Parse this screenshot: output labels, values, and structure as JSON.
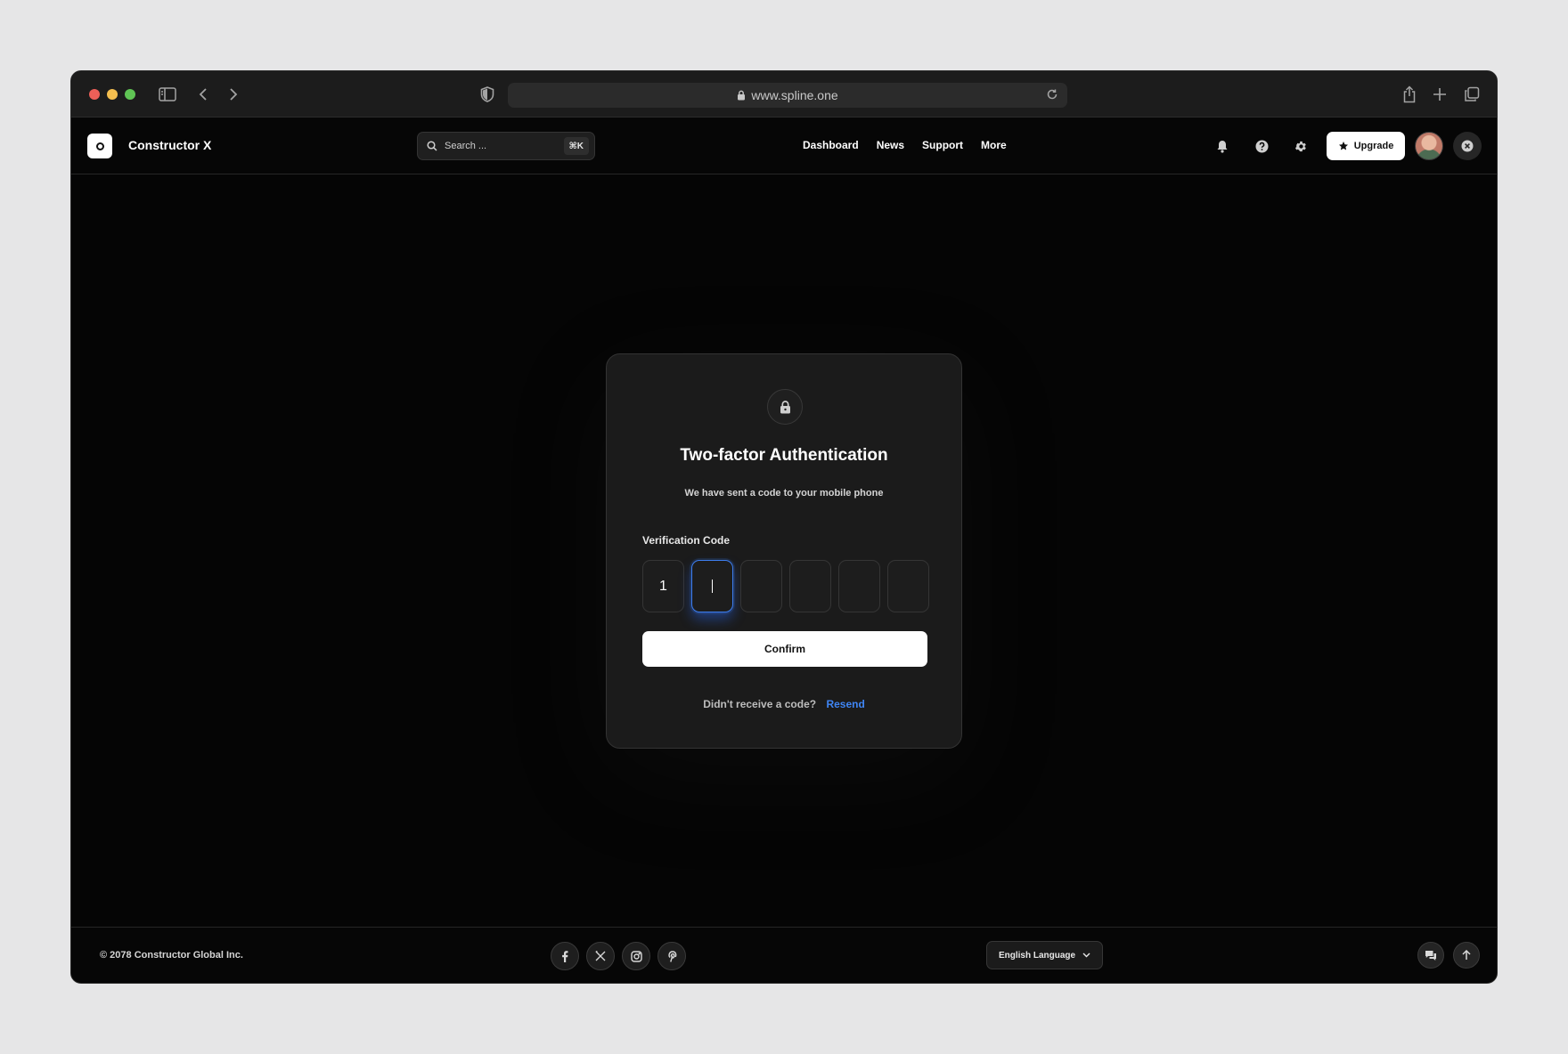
{
  "browser": {
    "url": "www.spline.one",
    "icons": [
      "sidebar-icon",
      "back-icon",
      "forward-icon",
      "shield-icon",
      "lock-icon",
      "reload-icon",
      "share-icon",
      "new-tab-icon",
      "tabs-icon"
    ]
  },
  "header": {
    "brand": "Constructor X",
    "search": {
      "placeholder": "Search ...",
      "shortcut": "⌘K"
    },
    "nav": [
      "Dashboard",
      "News",
      "Support",
      "More"
    ],
    "upgrade_label": "Upgrade"
  },
  "modal": {
    "title": "Two-factor Authentication",
    "subtitle": "We have sent a code to your mobile phone",
    "code_label": "Verification Code",
    "digits": [
      "1",
      "",
      "",
      "",
      "",
      ""
    ],
    "active_index": 1,
    "confirm_label": "Confirm",
    "resend_question": "Didn't receive a code?",
    "resend_link": "Resend"
  },
  "footer": {
    "copyright": "© 2078 Constructor Global Inc.",
    "language": "English Language"
  },
  "colors": {
    "accent": "#3f85f4",
    "background": "#050505",
    "card": "#1b1b1b"
  }
}
